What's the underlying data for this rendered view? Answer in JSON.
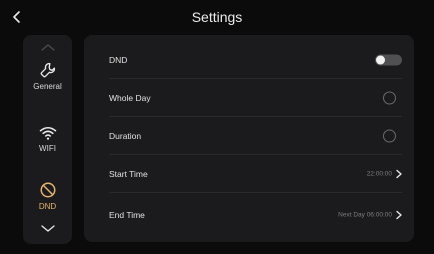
{
  "header": {
    "title": "Settings",
    "back_icon": "chevron-left-icon"
  },
  "sidebar": {
    "items": [
      {
        "label": "General",
        "icon": "wrench-icon",
        "active": false
      },
      {
        "label": "WIFI",
        "icon": "wifi-icon",
        "active": false
      },
      {
        "label": "DND",
        "icon": "do-not-disturb-icon",
        "active": true
      }
    ],
    "accent_color": "#e4b56f"
  },
  "settings": {
    "dnd": {
      "label": "DND",
      "enabled": false
    },
    "whole_day": {
      "label": "Whole Day",
      "selected": false
    },
    "duration": {
      "label": "Duration",
      "selected": false
    },
    "start_time": {
      "label": "Start Time",
      "value": "22:00:00"
    },
    "end_time": {
      "label": "End Time",
      "value": "Next Day 06:00:00"
    }
  }
}
